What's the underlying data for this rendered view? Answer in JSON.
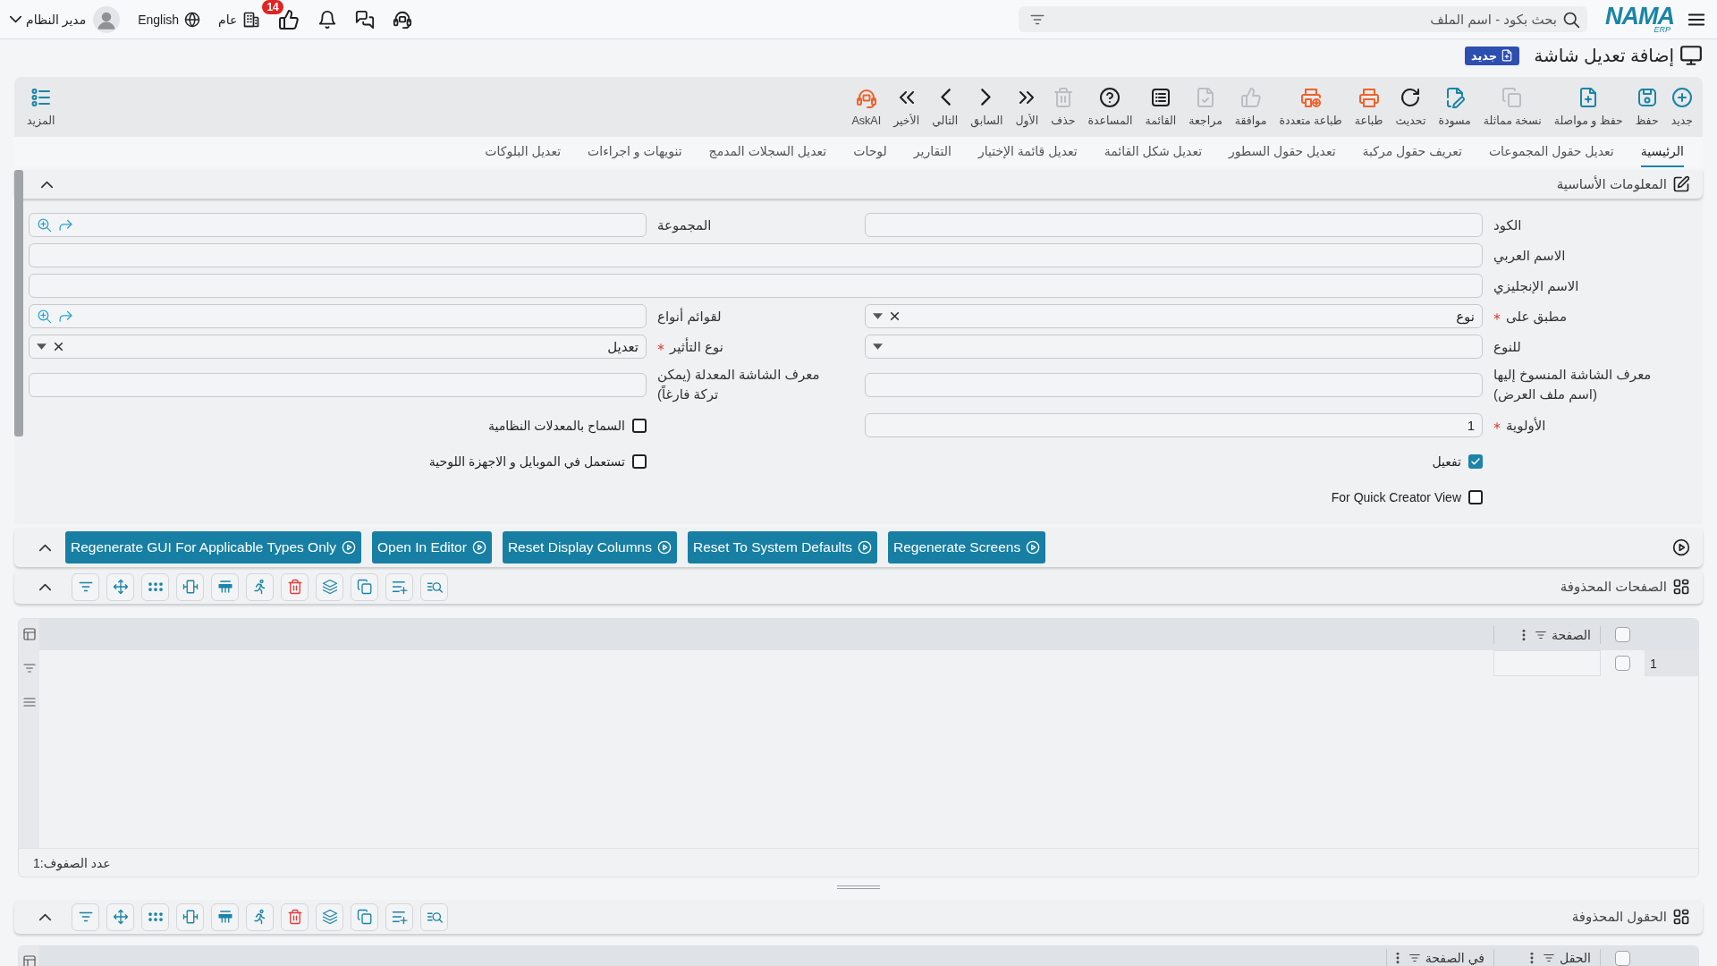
{
  "top_bar": {
    "logo": {
      "wordmark": "NAMA",
      "subtitle": "ERP"
    },
    "search": {
      "placeholder": "بحث بكود - اسم الملف"
    },
    "approvals_count": "14",
    "company": "عام",
    "language": "English",
    "user": "مدير النظام"
  },
  "page_header": {
    "title": "إضافة تعديل شاشة",
    "mode": "جديد"
  },
  "toolbar": {
    "items": [
      {
        "label": "جديد",
        "disabled": false
      },
      {
        "label": "حفظ",
        "disabled": false
      },
      {
        "label": "حفظ و مواصلة",
        "disabled": false
      },
      {
        "label": "نسخة مماثلة",
        "disabled": true
      },
      {
        "label": "مسودة",
        "disabled": false
      },
      {
        "label": "تحديث",
        "disabled": false
      },
      {
        "label": "طباعة",
        "disabled": false
      },
      {
        "label": "طباعة متعددة",
        "disabled": false
      },
      {
        "label": "موافقة",
        "disabled": true
      },
      {
        "label": "مراجعة",
        "disabled": true
      },
      {
        "label": "القائمة",
        "disabled": false
      },
      {
        "label": "المساعدة",
        "disabled": false
      },
      {
        "label": "حذف",
        "disabled": true
      },
      {
        "label": "الأول",
        "disabled": false
      },
      {
        "label": "السابق",
        "disabled": false
      },
      {
        "label": "التالي",
        "disabled": false
      },
      {
        "label": "الأخير",
        "disabled": false
      },
      {
        "label": "AskAI",
        "disabled": false
      }
    ],
    "more": "المزيد"
  },
  "tabs": [
    {
      "label": "الرئيسية",
      "selected": true
    },
    {
      "label": "تعديل حقول المجموعات",
      "selected": false
    },
    {
      "label": "تعريف حقول مركبة",
      "selected": false
    },
    {
      "label": "تعديل حقول السطور",
      "selected": false
    },
    {
      "label": "تعديل شكل القائمة",
      "selected": false
    },
    {
      "label": "تعديل قائمة الإختيار",
      "selected": false
    },
    {
      "label": "التقارير",
      "selected": false
    },
    {
      "label": "لوحات",
      "selected": false
    },
    {
      "label": "تعديل السجلات المدمج",
      "selected": false
    },
    {
      "label": "تنويهات و اجراءات",
      "selected": false
    },
    {
      "label": "تعديل البلوكات",
      "selected": false
    }
  ],
  "basic_info": {
    "title": "المعلومات الأساسية",
    "expanded": true,
    "fields": [
      {
        "label": "الكود",
        "kind": "text",
        "required": false
      },
      {
        "label": "المجموعة",
        "kind": "lookup",
        "required": false
      },
      {
        "label": "الاسم العربي",
        "kind": "wide",
        "required": false
      },
      {
        "label": "الاسم الإنجليزي",
        "kind": "wide",
        "required": false
      },
      {
        "label": "مطبق على",
        "kind": "select",
        "required": true,
        "value": "نوع"
      },
      {
        "label": "لقوائم أنواع",
        "kind": "lookup",
        "required": false
      },
      {
        "label": "للنوع",
        "kind": "select",
        "required": false
      },
      {
        "label": "نوع التأثير",
        "kind": "select",
        "required": true,
        "value": "تعديل"
      },
      {
        "label": "معرف الشاشة المنسوخ إليها (اسم ملف العرض)",
        "kind": "text",
        "required": false
      },
      {
        "label": "معرف الشاشة المعدلة (يمكن تركة فارغاً)",
        "kind": "text",
        "required": false
      },
      {
        "label": "الأولوية",
        "kind": "text",
        "required": true,
        "value": "1"
      },
      {
        "label": "السماح بالمعدلات النظامية",
        "kind": "checkbox",
        "checked": false
      },
      {
        "label": "تفعيل",
        "kind": "checkbox",
        "checked": true
      },
      {
        "label": "تستعمل في الموبايل و الاجهزة اللوحية",
        "kind": "checkbox",
        "checked": false
      },
      {
        "label": "For Quick Creator View",
        "kind": "checkbox",
        "checked": false
      }
    ]
  },
  "actions": {
    "expanded": true,
    "buttons": [
      "Regenerate Screens",
      "Reset To System Defaults",
      "Reset Display Columns",
      "Open In Editor",
      "Regenerate GUI For Applicable Types Only"
    ]
  },
  "deleted_pages": {
    "title": "الصفحات المحذوفة",
    "expanded": true,
    "columns": [
      "الصفحة"
    ],
    "header_checked": false,
    "rows": [
      {
        "number": "1",
        "checked": false
      }
    ],
    "row_count": "عدد الصفوف:1"
  },
  "deleted_fields": {
    "title": "الحقول المحذوفة",
    "expanded": true,
    "columns": [
      "الحقل",
      "في الصفحة"
    ],
    "header_checked": false
  }
}
